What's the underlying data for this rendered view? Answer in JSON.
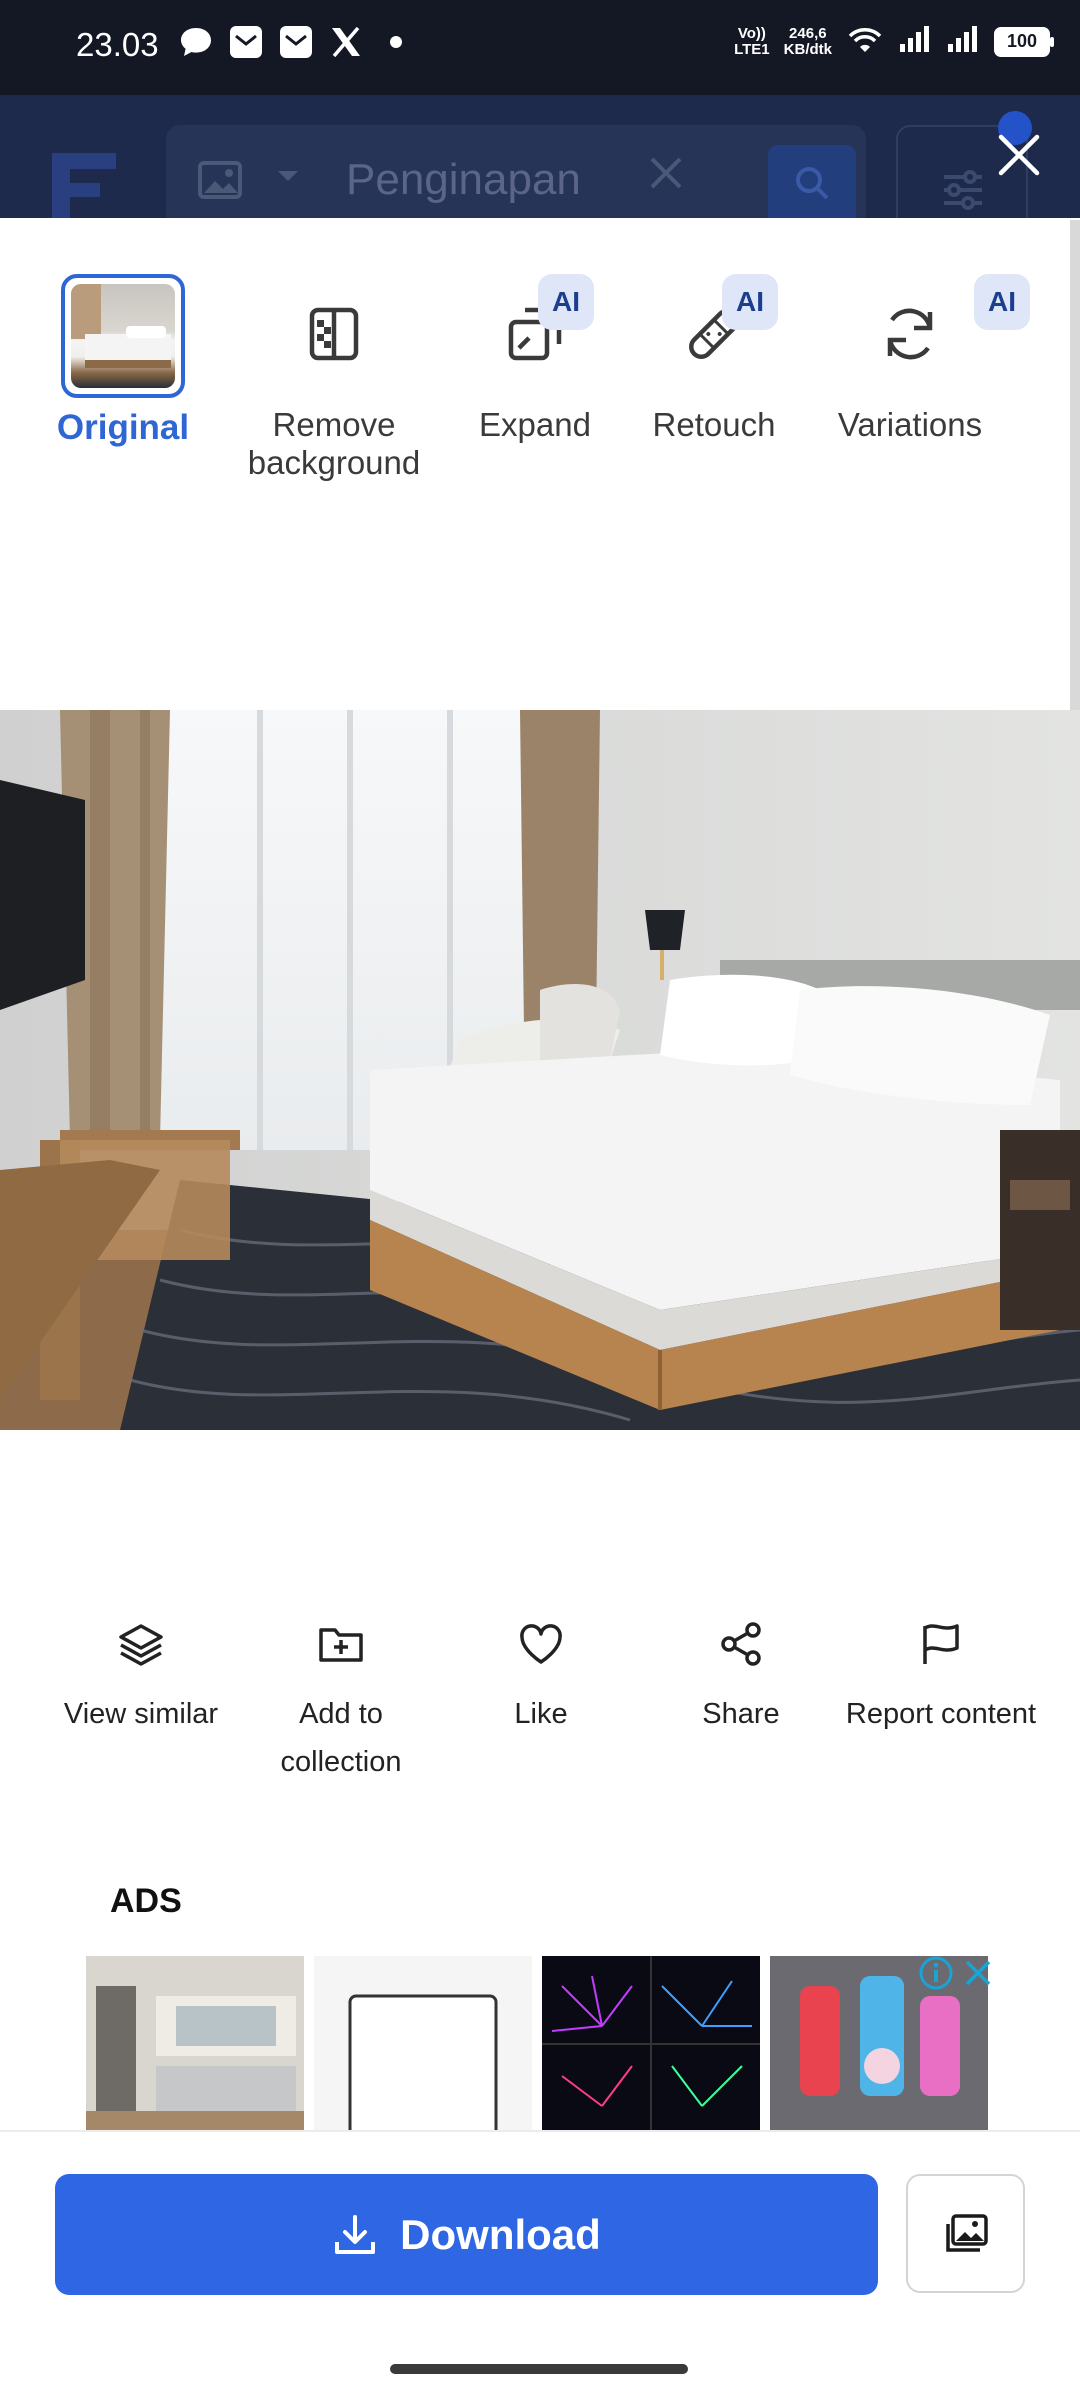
{
  "status_bar": {
    "time": "23.03",
    "network_speed_value": "246,6",
    "network_speed_unit": "KB/dtk",
    "volte_line1": "Vo))",
    "volte_line2": "LTE1",
    "battery": "100",
    "notification_icons": [
      "chat-bubble-icon",
      "mail-icon",
      "mail-icon",
      "x-logo-icon",
      "dot-icon"
    ]
  },
  "header": {
    "search_placeholder": "Penginapan"
  },
  "tools": [
    {
      "id": "original",
      "label": "Original",
      "selected": true,
      "ai": false
    },
    {
      "id": "remove-background",
      "label": "Remove background",
      "ai": false
    },
    {
      "id": "expand",
      "label": "Expand",
      "ai": true
    },
    {
      "id": "retouch",
      "label": "Retouch",
      "ai": true
    },
    {
      "id": "variations",
      "label": "Variations",
      "ai": true
    }
  ],
  "ai_badge": "AI",
  "actions": [
    {
      "id": "view-similar",
      "label": "View similar",
      "icon": "layers-icon"
    },
    {
      "id": "add-to-collection",
      "label": "Add to collection",
      "icon": "folder-plus-icon"
    },
    {
      "id": "like",
      "label": "Like",
      "icon": "heart-icon"
    },
    {
      "id": "share",
      "label": "Share",
      "icon": "share-icon"
    },
    {
      "id": "report-content",
      "label": "Report content",
      "icon": "flag-icon"
    }
  ],
  "ads": {
    "label": "ADS"
  },
  "download": {
    "label": "Download"
  },
  "colors": {
    "accent": "#2e66e4",
    "selected_text": "#2f66d6",
    "ai_badge_bg": "#dfe6f7",
    "status_bar_bg": "#141824"
  }
}
